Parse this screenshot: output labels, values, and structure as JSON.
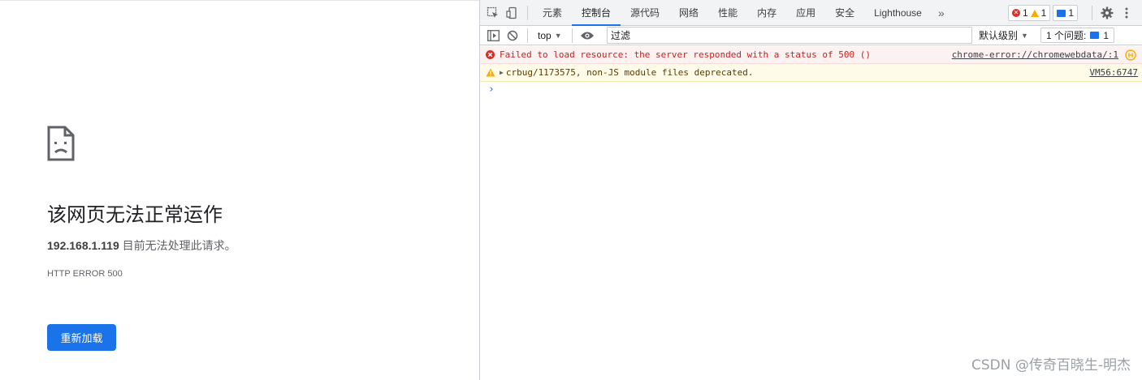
{
  "page": {
    "title": "该网页无法正常运作",
    "host": "192.168.1.119",
    "description_suffix": " 目前无法处理此请求。",
    "error_code": "HTTP ERROR 500",
    "reload_label": "重新加载"
  },
  "devtools": {
    "tabs": [
      {
        "label": "元素"
      },
      {
        "label": "控制台"
      },
      {
        "label": "源代码"
      },
      {
        "label": "网络"
      },
      {
        "label": "性能"
      },
      {
        "label": "内存"
      },
      {
        "label": "应用"
      },
      {
        "label": "安全"
      },
      {
        "label": "Lighthouse"
      }
    ],
    "active_tab": "控制台",
    "more_tabs": "»",
    "badges": {
      "errors": "1",
      "warnings": "1",
      "messages": "1"
    },
    "toolbar": {
      "context": "top",
      "filter_value": "过滤",
      "level": "默认级别",
      "issues_label": "1 个问题:",
      "issues_count": "1"
    },
    "console": {
      "rows": [
        {
          "level": "error",
          "text": "Failed to load resource: the server responded with a status of 500 ()",
          "source": "chrome-error://chromewebdata/:1"
        },
        {
          "level": "warning",
          "text": "crbug/1173575, non-JS module files deprecated.",
          "source": "VM56:6747"
        }
      ],
      "prompt": "›"
    }
  },
  "watermark": "CSDN @传奇百晓生-明杰",
  "colors": {
    "accent": "#1a73e8",
    "error": "#d93025",
    "warning": "#f9ab00"
  }
}
